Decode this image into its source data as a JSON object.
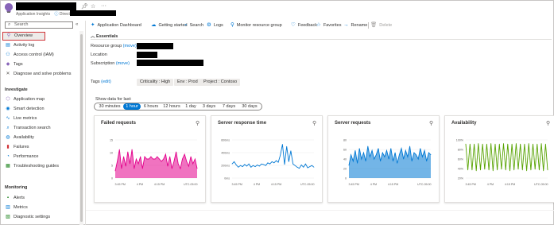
{
  "header": {
    "subtitle": "Application Insights",
    "directory_label": "Directory:",
    "pin_icon": "pin-icon",
    "favorite_icon": "star-icon",
    "more_label": "···"
  },
  "sidebar": {
    "search_placeholder": "Search",
    "collapse_label": "«",
    "items_top": [
      {
        "label": "Overview",
        "icon": "lightbulb-icon",
        "glyph": "⚲",
        "color": "#8764b8"
      },
      {
        "label": "Activity log",
        "icon": "activity-log-icon",
        "glyph": "▤",
        "color": "#0078d4"
      },
      {
        "label": "Access control (IAM)",
        "icon": "people-icon",
        "glyph": "⚇",
        "color": "#0078d4"
      },
      {
        "label": "Tags",
        "icon": "tag-icon",
        "glyph": "◆",
        "color": "#8764b8"
      },
      {
        "label": "Diagnose and solve problems",
        "icon": "wrench-icon",
        "glyph": "✕",
        "color": "#605e5c"
      }
    ],
    "section_investigate": "Investigate",
    "items_investigate": [
      {
        "label": "Application map",
        "icon": "app-map-icon",
        "glyph": "⬡",
        "color": "#8764b8"
      },
      {
        "label": "Smart detection",
        "icon": "smart-detection-icon",
        "glyph": "◉",
        "color": "#0078d4"
      },
      {
        "label": "Live metrics",
        "icon": "live-metrics-icon",
        "glyph": "∿",
        "color": "#0078d4"
      },
      {
        "label": "Transaction search",
        "icon": "search-icon",
        "glyph": "⌕",
        "color": "#0078d4"
      },
      {
        "label": "Availability",
        "icon": "globe-icon",
        "glyph": "◍",
        "color": "#0078d4"
      },
      {
        "label": "Failures",
        "icon": "failures-icon",
        "glyph": "▮",
        "color": "#d13438"
      },
      {
        "label": "Performance",
        "icon": "performance-icon",
        "glyph": "◔",
        "color": "#0078d4"
      },
      {
        "label": "Troubleshooting guides",
        "icon": "guide-icon",
        "glyph": "▦",
        "color": "#107c10"
      }
    ],
    "section_monitoring": "Monitoring",
    "items_monitoring": [
      {
        "label": "Alerts",
        "icon": "alerts-icon",
        "glyph": "▪",
        "color": "#107c10"
      },
      {
        "label": "Metrics",
        "icon": "metrics-icon",
        "glyph": "▥",
        "color": "#0078d4"
      },
      {
        "label": "Diagnostic settings",
        "icon": "settings-icon",
        "glyph": "▧",
        "color": "#107c10"
      }
    ]
  },
  "toolbar": {
    "items": [
      {
        "label": "Application Dashboard",
        "icon": "dashboard-icon",
        "glyph": "✦",
        "enabled": true
      },
      {
        "label": "Getting started",
        "icon": "getting-started-icon",
        "glyph": "☁",
        "enabled": true
      },
      {
        "label": "Search",
        "icon": "search-icon",
        "glyph": "⌕",
        "enabled": true
      },
      {
        "label": "Logs",
        "icon": "logs-icon",
        "glyph": "⚙",
        "enabled": true
      },
      {
        "label": "Monitor resource group",
        "icon": "monitor-icon",
        "glyph": "⚲",
        "enabled": true
      },
      {
        "label": "Feedback",
        "icon": "feedback-icon",
        "glyph": "♡",
        "enabled": true
      },
      {
        "label": "Favorites",
        "icon": "star-icon",
        "glyph": "☆",
        "enabled": true
      },
      {
        "label": "Rename",
        "icon": "rename-icon",
        "glyph": "→",
        "enabled": true
      },
      {
        "label": "Delete",
        "icon": "delete-icon",
        "glyph": "🗑",
        "enabled": false
      }
    ]
  },
  "essentials": {
    "title": "Essentials",
    "resource_group_label": "Resource group",
    "location_label": "Location",
    "subscription_label": "Subscription",
    "move_link": "(move)",
    "tags_label": "Tags",
    "tags_edit": "(edit)",
    "tags": [
      "Criticality : High",
      "Env : Prod",
      "Project : Contoso"
    ]
  },
  "time_range": {
    "label": "Show data for last:",
    "options": [
      "30 minutes",
      "1 hour",
      "6 hours",
      "12 hours",
      "1 day",
      "3 days",
      "7 days",
      "30 days"
    ],
    "selected": "1 hour"
  },
  "colors": {
    "accent": "#0078d4",
    "failed_requests": "#e3008c",
    "server_response": "#0078d4",
    "server_requests": "#0078d4",
    "availability": "#57a300"
  },
  "chart_data": [
    {
      "type": "area",
      "title": "Failed requests",
      "x_ticks": [
        "3:45 PM",
        "4 PM",
        "4:15 PM",
        "UTC-05:00"
      ],
      "y_ticks": [
        "15",
        "10",
        "5",
        "0"
      ],
      "ylim": [
        0,
        16
      ],
      "values": [
        3,
        7,
        12,
        4,
        9,
        5,
        11,
        6,
        12,
        4,
        8,
        6,
        9,
        4,
        9,
        8,
        8,
        9,
        8,
        8,
        9,
        8,
        7,
        8,
        10,
        5,
        9,
        4,
        7,
        11,
        6,
        4,
        8,
        10,
        7,
        5,
        9,
        6,
        8,
        4
      ]
    },
    {
      "type": "line",
      "title": "Server response time",
      "x_ticks": [
        "3:45 PM",
        "4 PM",
        "4:15 PM",
        "UTC-05:00"
      ],
      "y_ticks": [
        "600ms",
        "400ms",
        "200ms",
        "0ms"
      ],
      "ylim": [
        0,
        700
      ],
      "values": [
        260,
        300,
        240,
        200,
        230,
        210,
        250,
        220,
        260,
        200,
        230,
        210,
        240,
        220,
        260,
        250,
        230,
        280,
        260,
        300,
        280,
        320,
        290,
        420,
        620,
        250,
        580,
        300,
        500,
        260,
        230,
        200,
        180,
        240,
        200,
        260,
        190,
        210,
        230,
        200
      ]
    },
    {
      "type": "area",
      "title": "Server requests",
      "x_ticks": [
        "3:45 PM",
        "4 PM",
        "4:15 PM",
        "UTC-05:00"
      ],
      "y_ticks": [
        "80",
        "60",
        "40",
        "20",
        "0"
      ],
      "ylim": [
        0,
        90
      ],
      "values": [
        30,
        55,
        40,
        65,
        35,
        70,
        45,
        60,
        40,
        75,
        50,
        65,
        45,
        55,
        70,
        40,
        60,
        50,
        65,
        45,
        70,
        40,
        60,
        35,
        55,
        70,
        45,
        65,
        50,
        75,
        40,
        60,
        55,
        45,
        70,
        50,
        65,
        40,
        60,
        55
      ]
    },
    {
      "type": "line",
      "title": "Availability",
      "x_ticks": [
        "3:45 PM",
        "4 PM",
        "4:15 PM",
        "UTC-05:00"
      ],
      "y_ticks": [
        "100%",
        "80%",
        "60%",
        "40%",
        "20%"
      ],
      "ylim": [
        10,
        105
      ],
      "values": [
        95,
        30,
        95,
        30,
        95,
        28,
        96,
        30,
        95,
        32,
        95,
        30,
        96,
        28,
        95,
        30,
        95,
        32,
        96,
        30,
        95,
        28,
        95,
        30,
        96,
        32,
        95,
        30,
        95,
        28,
        96,
        30,
        95,
        32,
        95,
        30,
        96,
        28,
        95,
        30
      ]
    }
  ]
}
